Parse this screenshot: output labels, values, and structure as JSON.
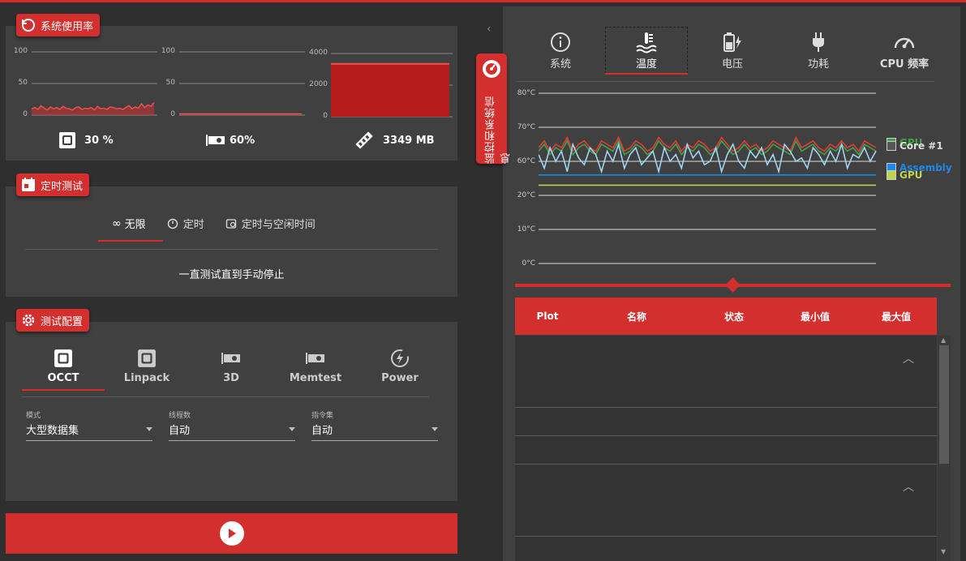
{
  "system_usage": {
    "title": "系统使用率",
    "cpu": {
      "ticks": [
        "100",
        "50",
        "0"
      ],
      "value_label": "30 %"
    },
    "gpu": {
      "ticks": [
        "100",
        "50",
        "0"
      ],
      "value_label": "60%"
    },
    "memory": {
      "ticks": [
        "4000",
        "2000",
        "0"
      ],
      "value_label": "3349 MB",
      "fill_fraction": 0.837
    }
  },
  "timed_test": {
    "title": "定时测试",
    "tabs": [
      {
        "label": "无限",
        "icon": "infinity-icon",
        "active": true
      },
      {
        "label": "定时",
        "icon": "timer-icon",
        "active": false
      },
      {
        "label": "定时与空闲时间",
        "icon": "timer-idle-icon",
        "active": false
      }
    ],
    "description": "一直测试直到手动停止"
  },
  "test_config": {
    "title": "测试配置",
    "tabs": [
      {
        "label": "OCCT",
        "icon": "cpu-icon",
        "active": true
      },
      {
        "label": "Linpack",
        "icon": "cpu-icon",
        "active": false
      },
      {
        "label": "3D",
        "icon": "gpu-icon",
        "active": false
      },
      {
        "label": "Memtest",
        "icon": "gpu-icon",
        "active": false
      },
      {
        "label": "Power",
        "icon": "power-icon",
        "active": false
      }
    ],
    "fields": [
      {
        "label": "模式",
        "value": "大型数据集"
      },
      {
        "label": "线程数",
        "value": "自动"
      },
      {
        "label": "指令集",
        "value": "自动"
      }
    ]
  },
  "monitor": {
    "side_label": "监控和系统信息",
    "tabs": [
      {
        "label": "系统",
        "icon": "info-icon"
      },
      {
        "label": "温度",
        "icon": "thermometer-icon",
        "active": true
      },
      {
        "label": "电压",
        "icon": "battery-icon"
      },
      {
        "label": "功耗",
        "icon": "plug-icon"
      },
      {
        "label": "CPU 频率",
        "icon": "speedometer-icon"
      }
    ],
    "legend": [
      {
        "label": "GPU",
        "color": "#43a047"
      },
      {
        "label": "Core #1",
        "color": "#e53935"
      },
      {
        "label": "Assembly",
        "color": "#1e88e5"
      },
      {
        "label": "GPU",
        "color": "#c0d34c"
      }
    ],
    "table": {
      "headers": [
        "Plot",
        "名称",
        "状态",
        "最小值",
        "最大值"
      ]
    }
  },
  "chart_data": {
    "type": "line",
    "ylabel": "",
    "y_ticks": [
      "80°C",
      "70°C",
      "60°C",
      "20°C",
      "10°C",
      "0°C"
    ],
    "grid": true,
    "legend": "right",
    "series": [
      {
        "name": "Core #1",
        "color": "#e53935",
        "values": [
          64,
          66,
          63,
          65,
          64,
          67,
          63,
          65,
          66,
          64,
          63,
          66,
          65,
          64,
          67,
          63,
          64,
          66,
          65,
          63,
          64,
          67,
          65,
          64,
          66,
          63,
          65,
          64,
          66,
          65,
          63,
          64,
          67,
          65,
          63,
          64,
          66,
          64,
          65,
          63,
          64,
          66,
          65,
          64,
          63,
          67,
          64,
          65,
          66,
          64,
          63,
          65,
          64,
          66,
          64,
          65,
          63,
          66,
          65,
          64
        ]
      },
      {
        "name": "GPU",
        "color": "#43a047",
        "values": [
          63,
          65,
          62,
          64,
          63,
          66,
          62,
          64,
          65,
          63,
          62,
          65,
          64,
          63,
          66,
          62,
          63,
          65,
          64,
          62,
          63,
          66,
          64,
          63,
          65,
          62,
          64,
          63,
          65,
          64,
          62,
          63,
          66,
          64,
          62,
          63,
          65,
          63,
          64,
          62,
          63,
          65,
          64,
          63,
          62,
          66,
          63,
          64,
          65,
          63,
          62,
          64,
          63,
          65,
          63,
          64,
          62,
          65,
          64,
          63
        ]
      },
      {
        "name": "Core",
        "color": "#9fd4f0",
        "values": [
          62,
          58,
          64,
          60,
          63,
          57,
          65,
          61,
          59,
          64,
          62,
          57,
          63,
          60,
          65,
          58,
          62,
          64,
          59,
          61,
          63,
          57,
          64,
          60,
          62,
          58,
          65,
          61,
          63,
          59,
          60,
          64,
          57,
          62,
          65,
          60,
          58,
          63,
          61,
          64,
          59,
          62,
          57,
          65,
          63,
          60,
          61,
          58,
          64,
          62,
          59,
          63,
          60,
          65,
          58,
          62,
          61,
          64,
          60,
          63
        ]
      },
      {
        "name": "Assembly",
        "color": "#1e88e5",
        "values": [
          56,
          56,
          56,
          56,
          56,
          56,
          56,
          56,
          56,
          56,
          56,
          56,
          56,
          56,
          56,
          56,
          56,
          56,
          56,
          56,
          56,
          56,
          56,
          56,
          56,
          56,
          56,
          56,
          56,
          56,
          56,
          56,
          56,
          56,
          56,
          56,
          56,
          56,
          56,
          56,
          56,
          56,
          56,
          56,
          56,
          56,
          56,
          56,
          56,
          56,
          56,
          56,
          56,
          56,
          56,
          56,
          56,
          56,
          56,
          56
        ]
      },
      {
        "name": "GPU",
        "color": "#c0d34c",
        "values": [
          53,
          53,
          53,
          53,
          53,
          53,
          53,
          53,
          53,
          53,
          53,
          53,
          53,
          53,
          53,
          53,
          53,
          53,
          53,
          53,
          53,
          53,
          53,
          53,
          53,
          53,
          53,
          53,
          53,
          53,
          53,
          53,
          53,
          53,
          53,
          53,
          53,
          53,
          53,
          53,
          53,
          53,
          53,
          53,
          53,
          53,
          53,
          53,
          53,
          53,
          53,
          53,
          53,
          53,
          53,
          53,
          53,
          53,
          53,
          53
        ]
      }
    ],
    "cpu_usage": [
      10,
      12,
      9,
      15,
      11,
      8,
      13,
      10,
      12,
      9,
      14,
      11,
      10,
      8,
      12,
      13,
      9,
      11,
      10,
      12,
      8,
      14,
      10,
      11,
      9,
      13,
      12,
      10,
      11,
      9,
      12,
      15,
      10,
      13,
      11,
      18,
      12,
      16,
      14,
      20
    ],
    "gpu_usage": [
      2,
      2,
      2,
      2,
      2,
      2,
      2,
      2,
      2,
      2,
      2,
      2,
      2,
      2,
      2,
      2,
      2,
      2,
      2,
      2,
      2,
      2,
      2,
      2,
      2,
      2,
      2,
      2,
      2,
      2,
      2,
      2,
      2,
      2,
      2,
      2,
      2,
      2,
      2,
      2
    ]
  }
}
